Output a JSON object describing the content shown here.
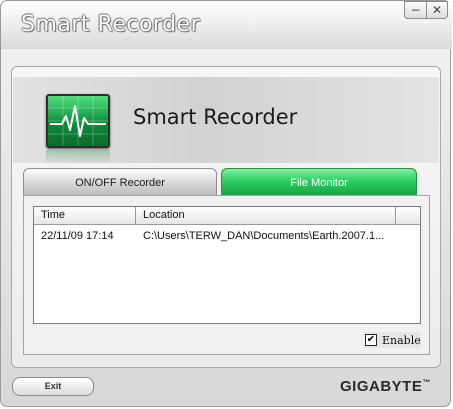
{
  "window": {
    "title": "Smart Recorder",
    "minimize_label": "−",
    "close_label": "✕"
  },
  "header": {
    "title": "Smart Recorder",
    "icon": "heartbeat-monitor-icon"
  },
  "tabs": [
    {
      "label": "ON/OFF Recorder",
      "active": false
    },
    {
      "label": "File Monitor",
      "active": true
    }
  ],
  "table": {
    "columns": [
      "Time",
      "Location"
    ],
    "rows": [
      {
        "time": "22/11/09 17:14",
        "location": "C:\\Users\\TERW_DAN\\Documents\\Earth.2007.1..."
      }
    ]
  },
  "enable": {
    "label": "Enable",
    "checked": true,
    "check_glyph": "✔"
  },
  "footer": {
    "exit_label": "Exit",
    "brand": "GIGABYTE",
    "brand_mark": "™"
  },
  "colors": {
    "active_tab": "#2fcf63",
    "icon_green": "#0f8a3c"
  }
}
